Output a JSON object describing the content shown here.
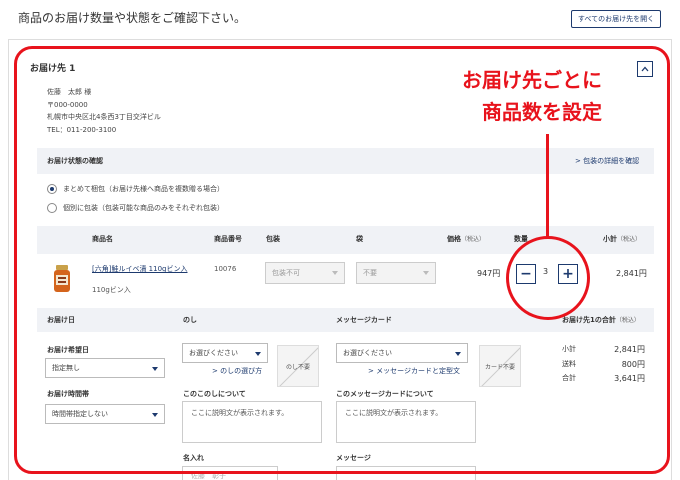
{
  "header": {
    "title": "商品のお届け数量や状態をご確認下さい。",
    "open_all_label": "すべてのお届け先を開く"
  },
  "destination": {
    "title": "お届け先 1",
    "collapse_symbol": "^",
    "address_lines": [
      "佐藤　太郎 様",
      "〒000-0000",
      "札幌市中央区北4条西3丁目交洋ビル",
      "TEL：011-200-3100"
    ]
  },
  "packing": {
    "section_label": "お届け状態の確認",
    "details_link": "> 包装の詳細を確認",
    "options": [
      {
        "label": "まとめて梱包（お届け先様へ商品を複数贈る場合）",
        "selected": true
      },
      {
        "label": "個別に包装（包装可能な商品のみをそれぞれ包装）",
        "selected": false
      }
    ]
  },
  "table": {
    "headers": {
      "product": "商品名",
      "code": "商品番号",
      "wrap": "包装",
      "bag": "袋",
      "price": "価格",
      "price_note": "（税込）",
      "qty": "数量",
      "subtotal": "小計",
      "subtotal_note": "（税込）"
    },
    "row": {
      "product_name": "[六角]鮭ルイベ漬 110gビン入",
      "product_sub": "110gビン入",
      "code": "10076",
      "wrap": "包装不可",
      "bag": "不要",
      "price": "947円",
      "qty": "3",
      "minus": "−",
      "plus": "+",
      "subtotal": "2,841円"
    }
  },
  "delivery": {
    "date_heading": "お届け日",
    "date_label": "お届け希望日",
    "date_value": "指定無し",
    "time_label": "お届け時間帯",
    "time_value": "時間帯指定しない"
  },
  "noshi": {
    "heading": "のし",
    "select_value": "お選びください",
    "link": "> のしの選び方",
    "sample": "のし不要",
    "about_label": "このこのしについて",
    "about_text": "ここに説明文が表示されます。",
    "name_label": "名入れ",
    "name_placeholder": "佐藤　彰子"
  },
  "card": {
    "heading": "メッセージカード",
    "select_value": "お選びください",
    "link": "> メッセージカードと定型文",
    "sample": "カード不要",
    "about_label": "このメッセージカードについて",
    "about_text": "ここに説明文が表示されます。",
    "message_label": "メッセージ"
  },
  "summary": {
    "heading": "お届け先1の合計",
    "heading_note": "（税込）",
    "rows": [
      {
        "label": "小計",
        "value": "2,841円"
      },
      {
        "label": "送料",
        "value": "800円"
      },
      {
        "label": "合計",
        "value": "3,641円"
      }
    ]
  },
  "annotation": {
    "lines": [
      "お届け先ごとに",
      "商品数を設定"
    ],
    "color": "#e8131c"
  }
}
